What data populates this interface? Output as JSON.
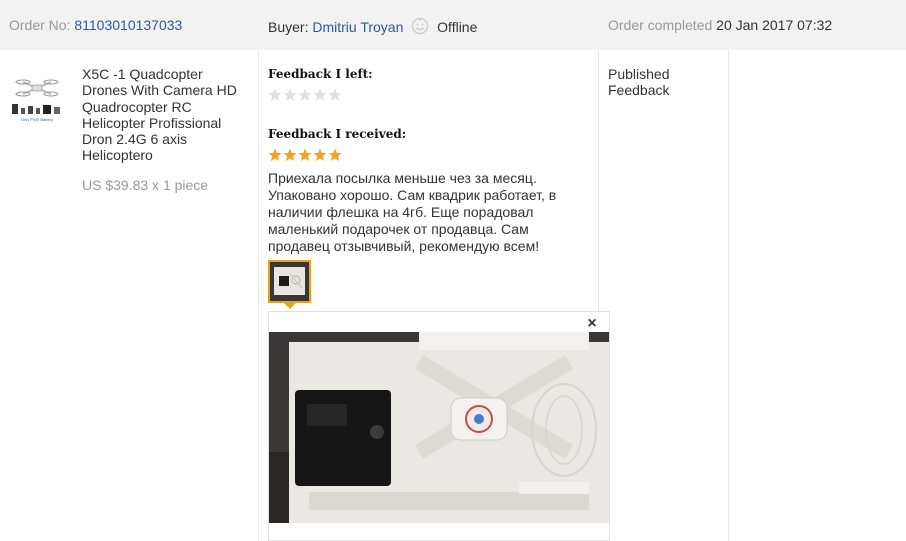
{
  "header": {
    "order_label": "Order No:",
    "order_number": "81103010137033",
    "buyer_label": "Buyer:",
    "buyer_name": "Dmitriu Troyan",
    "buyer_status": "Offline",
    "completed_label": "Order completed",
    "completed_date": "20 Jan 2017 07:32"
  },
  "product": {
    "title": "X5C -1 Quadcopter Drones With Camera HD Quadrocopter RC Helicopter Profissional Dron 2.4G 6 axis Helicoptero",
    "price": "US $39.83 x 1 piece",
    "thumb_caption": "Only FIVE Battery"
  },
  "feedback": {
    "left_label": "Feedback I left:",
    "left_rating": 0,
    "received_label": "Feedback I received:",
    "received_rating": 5,
    "review_text": "Приехала посылка меньше чез за месяц. Упаковано хорошо. Сам квадрик работает, в наличии флешка на 4гб. Еще порадовал маленький подарочек от продавца. Сам продавец отзывчивый, рекомендую всем!",
    "close_symbol": "×"
  },
  "status": {
    "text": "Published Feedback"
  },
  "colors": {
    "link": "#2a5aa6",
    "star_filled": "#f7a21b",
    "star_empty": "#e0e0e0",
    "thumb_border": "#e8a317",
    "header_bg": "#f2f2f2"
  }
}
